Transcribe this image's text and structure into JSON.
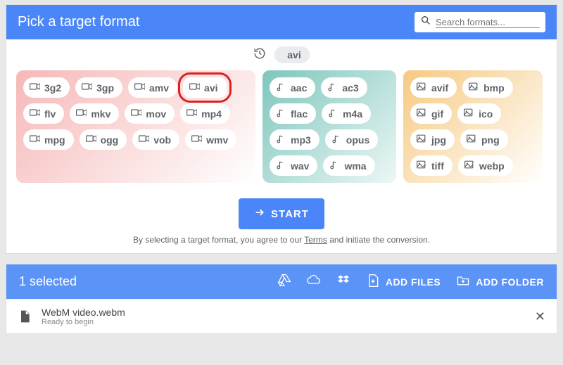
{
  "header": {
    "title": "Pick a target format",
    "search_placeholder": "Search formats..."
  },
  "recent": {
    "label": "avi"
  },
  "groups": {
    "video": [
      {
        "label": "3g2"
      },
      {
        "label": "3gp"
      },
      {
        "label": "amv"
      },
      {
        "label": "avi",
        "highlight": true
      },
      {
        "label": "flv"
      },
      {
        "label": "mkv"
      },
      {
        "label": "mov"
      },
      {
        "label": "mp4"
      },
      {
        "label": "mpg"
      },
      {
        "label": "ogg"
      },
      {
        "label": "vob"
      },
      {
        "label": "wmv"
      }
    ],
    "audio": [
      {
        "label": "aac"
      },
      {
        "label": "ac3"
      },
      {
        "label": "flac"
      },
      {
        "label": "m4a"
      },
      {
        "label": "mp3"
      },
      {
        "label": "opus"
      },
      {
        "label": "wav"
      },
      {
        "label": "wma"
      }
    ],
    "image": [
      {
        "label": "avif"
      },
      {
        "label": "bmp"
      },
      {
        "label": "gif"
      },
      {
        "label": "ico"
      },
      {
        "label": "jpg"
      },
      {
        "label": "png"
      },
      {
        "label": "tiff"
      },
      {
        "label": "webp"
      }
    ]
  },
  "start": {
    "label": "START"
  },
  "disclaimer": {
    "pre": "By selecting a target format, you agree to our ",
    "link": "Terms",
    "post": " and initiate the conversion."
  },
  "toolbar": {
    "selected": "1 selected",
    "add_files": "ADD FILES",
    "add_folder": "ADD FOLDER"
  },
  "file": {
    "name": "WebM video.webm",
    "status": "Ready to begin"
  }
}
